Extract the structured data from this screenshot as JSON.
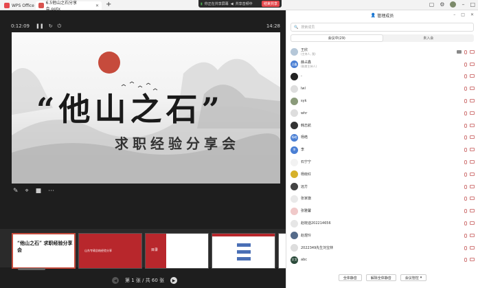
{
  "tabs": [
    {
      "label": "WPS Office",
      "color": "#e5484d"
    },
    {
      "label": "6.5他山之石分享会.pptx",
      "color": "#d9534f"
    }
  ],
  "sharebar": {
    "sharing": "你正在共享屏幕",
    "audio": "共享音频中",
    "stop": "结束共享"
  },
  "player": {
    "elapsed": "0:12:09",
    "clock": "14:28",
    "slide": {
      "title": "“他山之石”",
      "subtitle": "求职经验分享会"
    },
    "nav": {
      "page": "第 1 张 / 共 60 张"
    }
  },
  "thumbnails": [
    {
      "label": "“他山之石” 求职经验分享会"
    },
    {
      "label": "山东专硕总结经验分享"
    },
    {
      "label": "目录"
    },
    {
      "label": ""
    },
    {
      "label": ""
    }
  ],
  "panel": {
    "title": "管理成员",
    "search_placeholder": "搜索成员",
    "tabs": [
      "会议中(29)",
      "未入会"
    ],
    "members": [
      {
        "name": "王欣",
        "role": "(主持人, 我)",
        "avatar": "#b5c7d8",
        "avatar_text": ""
      },
      {
        "name": "薛占鑫",
        "role": "(联席主持人)",
        "avatar": "#4a7fd4",
        "avatar_text": "占鑫"
      },
      {
        "name": "-",
        "role": "",
        "avatar": "#222",
        "avatar_text": ""
      },
      {
        "name": "lwl",
        "role": "",
        "avatar": "#ddd",
        "avatar_text": ""
      },
      {
        "name": "syk",
        "role": "",
        "avatar": "#8a9a7a",
        "avatar_text": ""
      },
      {
        "name": "whr",
        "role": "",
        "avatar": "#ddd",
        "avatar_text": ""
      },
      {
        "name": "韩志航",
        "role": "",
        "avatar": "#333",
        "avatar_text": ""
      },
      {
        "name": "杨皓",
        "role": "",
        "avatar": "#4a7fd4",
        "avatar_text": "杨皓"
      },
      {
        "name": "李",
        "role": "",
        "avatar": "#4a7fd4",
        "avatar_text": "李"
      },
      {
        "name": "石宁宁",
        "role": "",
        "avatar": "#f2f2f2",
        "avatar_text": ""
      },
      {
        "name": "杨晓红",
        "role": "",
        "avatar": "#d6b12a",
        "avatar_text": ""
      },
      {
        "name": "远方",
        "role": "",
        "avatar": "#444",
        "avatar_text": ""
      },
      {
        "name": "张家旗",
        "role": "",
        "avatar": "#e9e9e9",
        "avatar_text": ""
      },
      {
        "name": "张雅馨",
        "role": "",
        "avatar": "#f0c9c9",
        "avatar_text": ""
      },
      {
        "name": "赵晓迪202214656",
        "role": "",
        "avatar": "#e6e6e6",
        "avatar_text": ""
      },
      {
        "name": "赵煜玲",
        "role": "",
        "avatar": "#556b8a",
        "avatar_text": ""
      },
      {
        "name": "2022349先生刘宝林",
        "role": "",
        "avatar": "#ddd",
        "avatar_text": ""
      },
      {
        "name": "abc",
        "role": "",
        "avatar": "#2a4a3a",
        "avatar_text": "文戈"
      }
    ],
    "footer": {
      "mute_all": "全体静音",
      "unmute_all": "解除全体静音",
      "manage": "会议管控"
    }
  }
}
